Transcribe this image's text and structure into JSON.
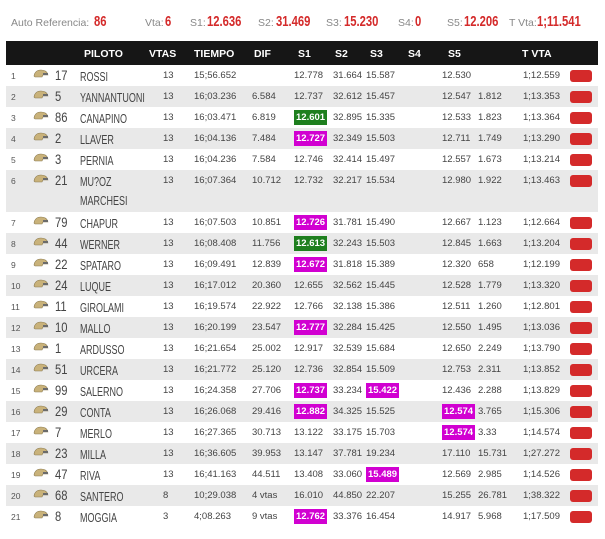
{
  "topbar": {
    "auto_ref_label": "Auto Referencia:",
    "auto_ref_value": "86",
    "vta_label": "Vta:",
    "vta_value": "6",
    "s1_label": "S1:",
    "s1_value": "12.636",
    "s2_label": "S2:",
    "s2_value": "31.469",
    "s3_label": "S3:",
    "s3_value": "15.230",
    "s4_label": "S4:",
    "s4_value": "0",
    "s5_label": "S5:",
    "s5_value": "12.206",
    "tvta_label": "T Vta:",
    "tvta_value": "1;11.541"
  },
  "headers": {
    "piloto": "PILOTO",
    "vtas": "VTAS",
    "tiempo": "TIEMPO",
    "dif": "DIF",
    "s1": "S1",
    "s2": "S2",
    "s3": "S3",
    "s4": "S4",
    "s5": "S5",
    "tvta": "T VTA"
  },
  "colors": {
    "accent_red": "#d42a2a",
    "purple": "#d100d1",
    "green": "#1e7f1e",
    "header_bg": "#161616"
  },
  "rows": [
    {
      "pos": "1",
      "num": "17",
      "name": "ROSSI",
      "vtas": "13",
      "tiempo": "15;56.652",
      "dif": "",
      "s1": "12.778",
      "s2": "31.664",
      "s3": "15.587",
      "s5": "12.530",
      "d5": "",
      "tvta": "1;12.559",
      "s1_hl": "",
      "s3_hl": "",
      "s5_hl": ""
    },
    {
      "pos": "2",
      "num": "5",
      "name": "YANNANTUONI",
      "vtas": "13",
      "tiempo": "16;03.236",
      "dif": "6.584",
      "s1": "12.737",
      "s2": "32.612",
      "s3": "15.457",
      "s5": "12.547",
      "d5": "1.812",
      "tvta": "1;13.353",
      "s1_hl": "",
      "s3_hl": "",
      "s5_hl": ""
    },
    {
      "pos": "3",
      "num": "86",
      "name": "CANAPINO",
      "vtas": "13",
      "tiempo": "16;03.471",
      "dif": "6.819",
      "s1": "12.601",
      "s2": "32.895",
      "s3": "15.335",
      "s5": "12.533",
      "d5": "1.823",
      "tvta": "1;13.364",
      "s1_hl": "green",
      "s3_hl": "",
      "s5_hl": ""
    },
    {
      "pos": "4",
      "num": "2",
      "name": "LLAVER",
      "vtas": "13",
      "tiempo": "16;04.136",
      "dif": "7.484",
      "s1": "12.727",
      "s2": "32.349",
      "s3": "15.503",
      "s5": "12.711",
      "d5": "1.749",
      "tvta": "1;13.290",
      "s1_hl": "purple",
      "s3_hl": "",
      "s5_hl": ""
    },
    {
      "pos": "5",
      "num": "3",
      "name": "PERNIA",
      "vtas": "13",
      "tiempo": "16;04.236",
      "dif": "7.584",
      "s1": "12.746",
      "s2": "32.414",
      "s3": "15.497",
      "s5": "12.557",
      "d5": "1.673",
      "tvta": "1;13.214",
      "s1_hl": "",
      "s3_hl": "",
      "s5_hl": ""
    },
    {
      "pos": "6",
      "num": "21",
      "name": "MU?OZ MARCHESI",
      "vtas": "13",
      "tiempo": "16;07.364",
      "dif": "10.712",
      "s1": "12.732",
      "s2": "32.217",
      "s3": "15.534",
      "s5": "12.980",
      "d5": "1.922",
      "tvta": "1;13.463",
      "s1_hl": "",
      "s3_hl": "",
      "s5_hl": "",
      "tall": true
    },
    {
      "pos": "7",
      "num": "79",
      "name": "CHAPUR",
      "vtas": "13",
      "tiempo": "16;07.503",
      "dif": "10.851",
      "s1": "12.726",
      "s2": "31.781",
      "s3": "15.490",
      "s5": "12.667",
      "d5": "1.123",
      "tvta": "1;12.664",
      "s1_hl": "purple",
      "s3_hl": "",
      "s5_hl": ""
    },
    {
      "pos": "8",
      "num": "44",
      "name": "WERNER",
      "vtas": "13",
      "tiempo": "16;08.408",
      "dif": "11.756",
      "s1": "12.613",
      "s2": "32.243",
      "s3": "15.503",
      "s5": "12.845",
      "d5": "1.663",
      "tvta": "1;13.204",
      "s1_hl": "green",
      "s3_hl": "",
      "s5_hl": ""
    },
    {
      "pos": "9",
      "num": "22",
      "name": "SPATARO",
      "vtas": "13",
      "tiempo": "16;09.491",
      "dif": "12.839",
      "s1": "12.672",
      "s2": "31.818",
      "s3": "15.389",
      "s5": "12.320",
      "d5": "658",
      "tvta": "1;12.199",
      "s1_hl": "purple",
      "s3_hl": "",
      "s5_hl": ""
    },
    {
      "pos": "10",
      "num": "24",
      "name": "LUQUE",
      "vtas": "13",
      "tiempo": "16;17.012",
      "dif": "20.360",
      "s1": "12.655",
      "s2": "32.562",
      "s3": "15.445",
      "s5": "12.528",
      "d5": "1.779",
      "tvta": "1;13.320",
      "s1_hl": "",
      "s3_hl": "",
      "s5_hl": ""
    },
    {
      "pos": "11",
      "num": "11",
      "name": "GIROLAMI",
      "vtas": "13",
      "tiempo": "16;19.574",
      "dif": "22.922",
      "s1": "12.766",
      "s2": "32.138",
      "s3": "15.386",
      "s5": "12.511",
      "d5": "1.260",
      "tvta": "1;12.801",
      "s1_hl": "",
      "s3_hl": "",
      "s5_hl": ""
    },
    {
      "pos": "12",
      "num": "10",
      "name": "MALLO",
      "vtas": "13",
      "tiempo": "16;20.199",
      "dif": "23.547",
      "s1": "12.777",
      "s2": "32.284",
      "s3": "15.425",
      "s5": "12.550",
      "d5": "1.495",
      "tvta": "1;13.036",
      "s1_hl": "purple",
      "s3_hl": "",
      "s5_hl": ""
    },
    {
      "pos": "13",
      "num": "1",
      "name": "ARDUSSO",
      "vtas": "13",
      "tiempo": "16;21.654",
      "dif": "25.002",
      "s1": "12.917",
      "s2": "32.539",
      "s3": "15.684",
      "s5": "12.650",
      "d5": "2.249",
      "tvta": "1;13.790",
      "s1_hl": "",
      "s3_hl": "",
      "s5_hl": ""
    },
    {
      "pos": "14",
      "num": "51",
      "name": "URCERA",
      "vtas": "13",
      "tiempo": "16;21.772",
      "s1": "12.736",
      "dif": "25.120",
      "s2": "32.854",
      "s3": "15.509",
      "s5": "12.753",
      "d5": "2.311",
      "tvta": "1;13.852",
      "s1_hl": "",
      "s3_hl": "",
      "s5_hl": ""
    },
    {
      "pos": "15",
      "num": "99",
      "name": "SALERNO",
      "vtas": "13",
      "tiempo": "16;24.358",
      "dif": "27.706",
      "s1": "12.737",
      "s2": "33.234",
      "s3": "15.422",
      "s5": "12.436",
      "d5": "2.288",
      "tvta": "1;13.829",
      "s1_hl": "purple",
      "s3_hl": "purple",
      "s5_hl": ""
    },
    {
      "pos": "16",
      "num": "29",
      "name": "CONTA",
      "vtas": "13",
      "tiempo": "16;26.068",
      "dif": "29.416",
      "s1": "12.882",
      "s2": "34.325",
      "s3": "15.525",
      "s5": "12.574",
      "d5": "3.765",
      "tvta": "1;15.306",
      "s1_hl": "purple",
      "s3_hl": "",
      "s5_hl": "purple"
    },
    {
      "pos": "17",
      "num": "7",
      "name": "MERLO",
      "vtas": "13",
      "tiempo": "16;27.365",
      "dif": "30.713",
      "s1": "13.122",
      "s2": "33.175",
      "s3": "15.703",
      "s5": "12.574",
      "d5": "3.33",
      "tvta": "1;14.574",
      "s1_hl": "",
      "s3_hl": "",
      "s5_hl": "purple"
    },
    {
      "pos": "18",
      "num": "23",
      "name": "MILLA",
      "vtas": "13",
      "tiempo": "16;36.605",
      "dif": "39.953",
      "s1": "13.147",
      "s2": "37.781",
      "s3": "19.234",
      "s5": "17.110",
      "d5": "15.731",
      "tvta": "1;27.272",
      "s1_hl": "",
      "s3_hl": "",
      "s5_hl": ""
    },
    {
      "pos": "19",
      "num": "47",
      "name": "RIVA",
      "vtas": "13",
      "tiempo": "16;41.163",
      "dif": "44.511",
      "s1": "13.408",
      "s2": "33.060",
      "s3": "15.489",
      "s5": "12.569",
      "d5": "2.985",
      "tvta": "1;14.526",
      "s1_hl": "",
      "s3_hl": "purple",
      "s5_hl": ""
    },
    {
      "pos": "20",
      "num": "68",
      "name": "SANTERO",
      "vtas": "8",
      "tiempo": "10;29.038",
      "dif": "4 vtas",
      "s1": "16.010",
      "s2": "44.850",
      "s3": "22.207",
      "s5": "15.255",
      "d5": "26.781",
      "tvta": "1;38.322",
      "s1_hl": "",
      "s3_hl": "",
      "s5_hl": ""
    },
    {
      "pos": "21",
      "num": "8",
      "name": "MOGGIA",
      "vtas": "3",
      "tiempo": "4;08.263",
      "dif": "9 vtas",
      "s1": "12.762",
      "s2": "33.376",
      "s3": "16.454",
      "s5": "14.917",
      "d5": "5.968",
      "tvta": "1;17.509",
      "s1_hl": "purple",
      "s3_hl": "",
      "s5_hl": ""
    }
  ]
}
